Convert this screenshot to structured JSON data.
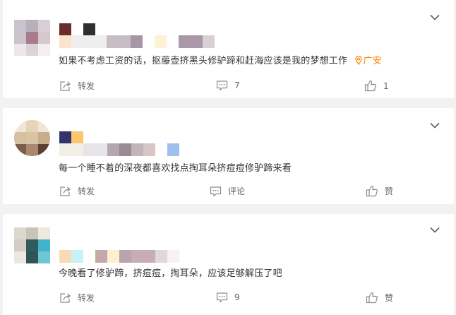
{
  "comments": [
    {
      "text": "如果不考虑工资的话，抠藤壶挤黑头修驴蹄和赶海应该是我的梦想工作",
      "location": "广安",
      "actions": {
        "share": "转发",
        "comment": "7",
        "like": "1"
      }
    },
    {
      "text": "每一个睡不着的深夜都喜欢找点掏耳朵挤痘痘修驴蹄来看",
      "actions": {
        "share": "转发",
        "comment": "评论",
        "like": "赞"
      }
    },
    {
      "text": "今晚看了修驴蹄，挤痘痘，掏耳朵，应该足够解压了吧",
      "actions": {
        "share": "转发",
        "comment": "9",
        "like": "赞"
      }
    }
  ],
  "icons": {
    "share": "share-icon",
    "comment": "comment-icon",
    "like": "thumbs-up-icon",
    "more": "chevron-down-icon",
    "location": "location-pin-icon"
  },
  "colors": {
    "location": "#ff8200",
    "text": "#333333",
    "action": "#636363",
    "background": "#f2f2f2"
  }
}
